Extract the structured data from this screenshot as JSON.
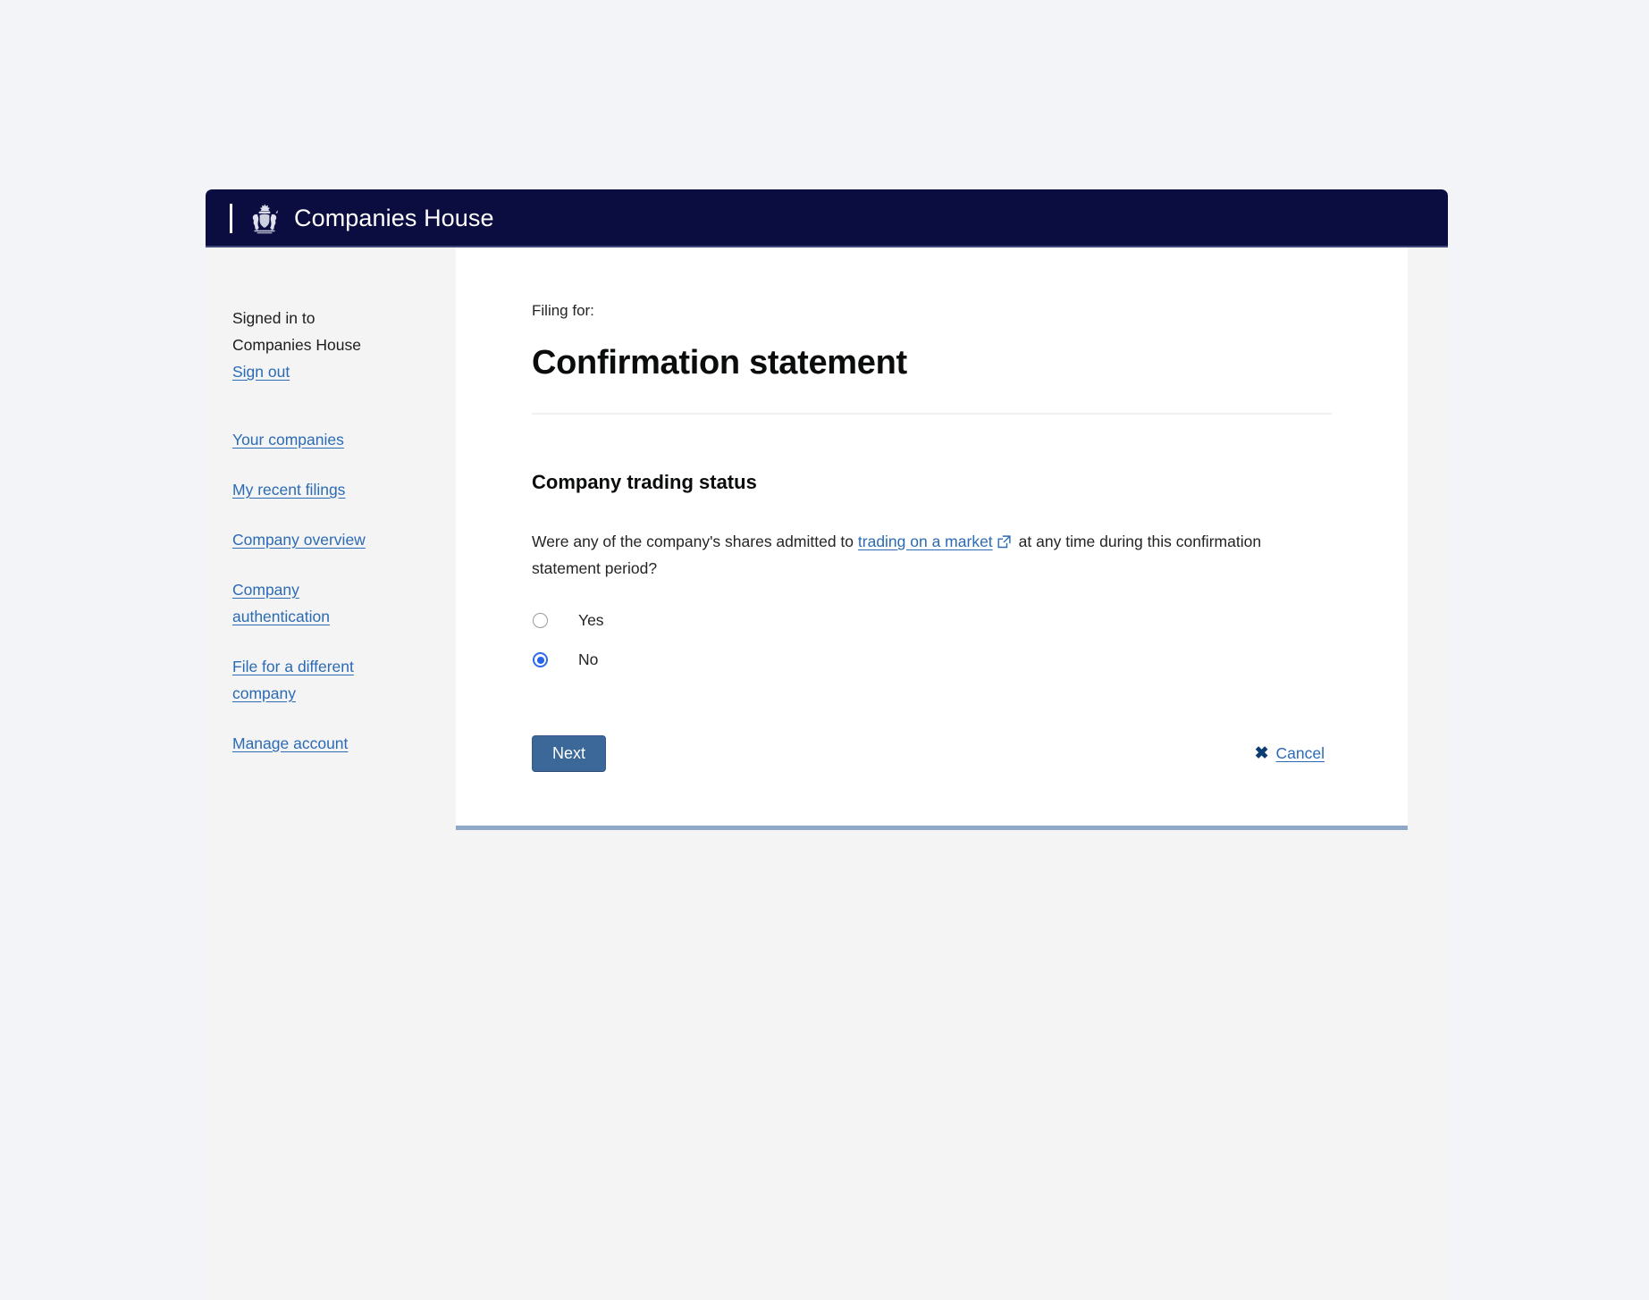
{
  "header": {
    "brand_title": "Companies House",
    "crest_icon": "royal-coat-of-arms-icon",
    "background_color": "#0b0c40"
  },
  "sidebar": {
    "signed_in_line1": "Signed in to",
    "signed_in_line2": "Companies House",
    "sign_out_label": "Sign out",
    "items": [
      {
        "label": "Your companies"
      },
      {
        "label": "My recent filings"
      },
      {
        "label": "Company overview"
      },
      {
        "label": "Company authentication"
      },
      {
        "label": "File for a different company"
      },
      {
        "label": "Manage account"
      }
    ]
  },
  "main": {
    "filing_for_label": "Filing for:",
    "company_name": "",
    "page_title": "Confirmation statement",
    "section_heading": "Company trading status",
    "question": {
      "part1": "Were any of the company's shares admitted to",
      "link_label": "trading on a market",
      "external_link_icon": "external-link-icon",
      "part2": "at any time during this confirmation statement period?"
    },
    "radios": {
      "name": "trading-status",
      "options": [
        {
          "label": "Yes",
          "value": "yes",
          "checked": false
        },
        {
          "label": "No",
          "value": "no",
          "checked": true
        }
      ],
      "selected_value": "no",
      "selected_color": "#2563eb"
    },
    "actions": {
      "next_label": "Next",
      "next_color": "#3b6899",
      "cancel_label": "Cancel",
      "cancel_icon": "close-x-icon"
    }
  },
  "theme": {
    "page_background": "#f2f4f8",
    "panel_background": "#f4f4f4",
    "card_background": "#ffffff",
    "link_color": "#2b6bb5",
    "card_bottom_border": "#8fa7c8"
  }
}
